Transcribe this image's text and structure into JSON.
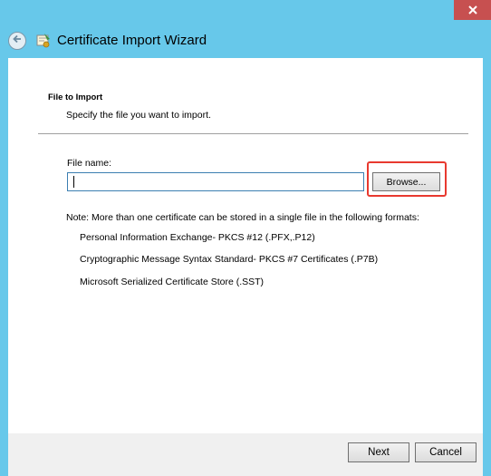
{
  "window": {
    "title": "Certificate Import Wizard",
    "close_icon": "close-icon",
    "back_icon": "back-arrow-icon",
    "app_icon": "certificate-wizard-icon",
    "close_color": "#c75050",
    "frame_color": "#67c8ea"
  },
  "page": {
    "section_title": "File to Import",
    "section_subtitle": "Specify the file you want to import."
  },
  "file_input": {
    "label": "File name:",
    "value": ""
  },
  "browse": {
    "label": "Browse...",
    "highlight_color": "#e8392f"
  },
  "note": {
    "text": "Note:  More than one certificate can be stored in a single file in the following formats:",
    "formats": [
      "Personal Information Exchange- PKCS #12 (.PFX,.P12)",
      "Cryptographic Message Syntax Standard- PKCS #7 Certificates (.P7B)",
      "Microsoft Serialized Certificate Store (.SST)"
    ]
  },
  "footer": {
    "next_label": "Next",
    "cancel_label": "Cancel"
  }
}
